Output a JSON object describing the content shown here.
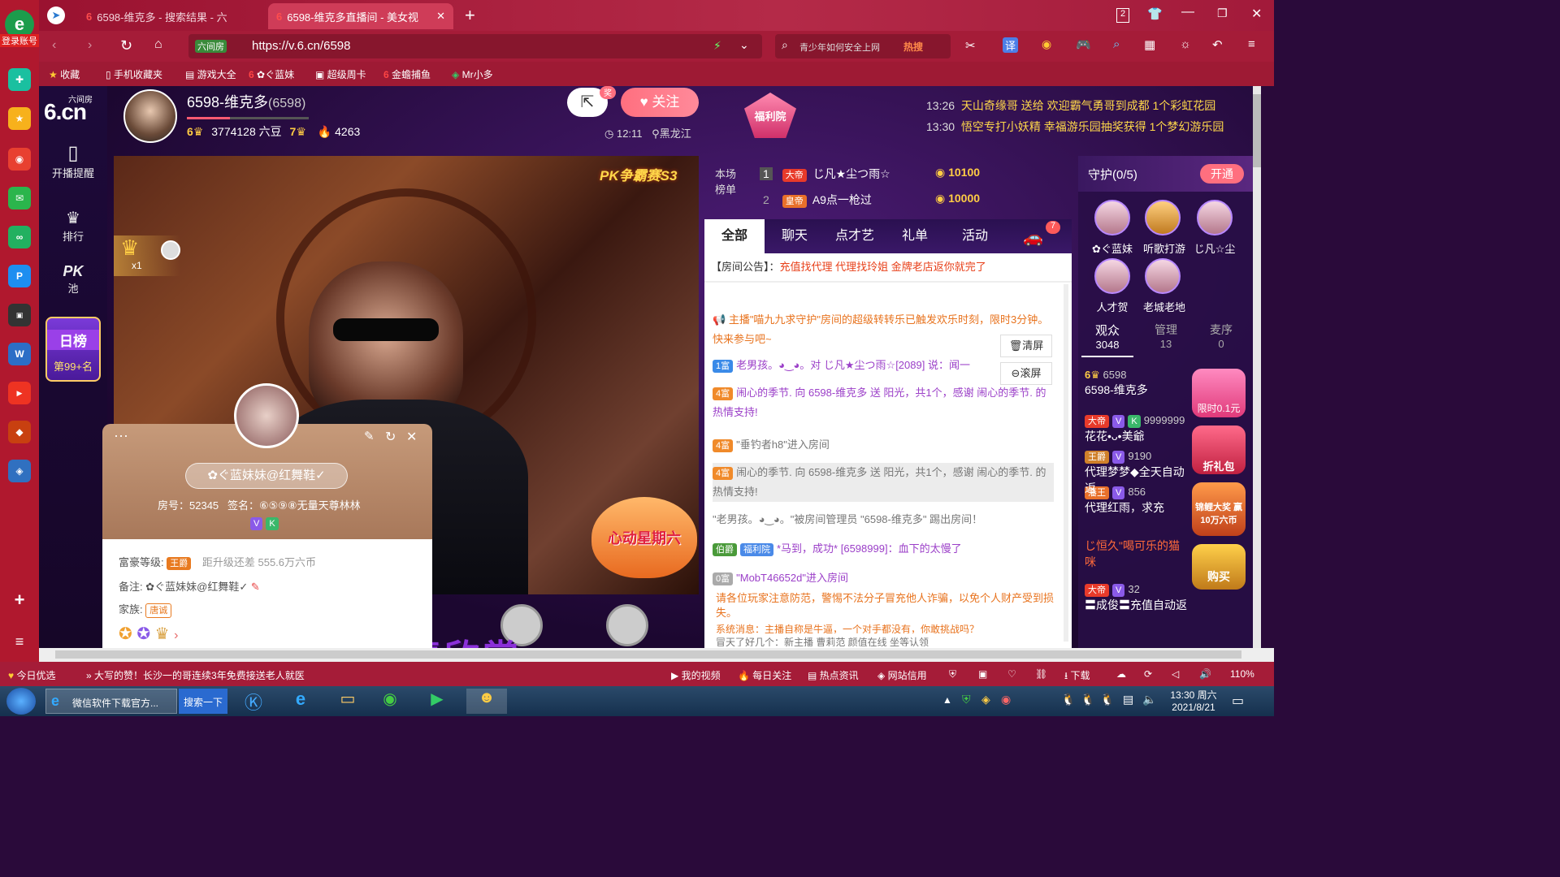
{
  "browser": {
    "login_label": "登录账号",
    "tabs": [
      {
        "label": "6598-维克多 - 搜索结果 - 六"
      },
      {
        "label": "6598-维克多直播间 - 美女视"
      }
    ],
    "tab_count": "2",
    "url": "https://v.6.cn/6598",
    "secure_label": "六间房",
    "search_placeholder": "青少年如何安全上网",
    "search_hot": "热搜",
    "bookmarks": [
      "收藏",
      "手机收藏夹",
      "游戏大全",
      "ぐ蓝妹",
      "超级周卡",
      "金蟾捕鱼",
      "Mr小多"
    ]
  },
  "site": {
    "logo_top": "六间房",
    "logo_main": "6.cn",
    "nav": [
      {
        "label": "开播提醒"
      },
      {
        "label": "排行"
      },
      {
        "label": "池"
      }
    ],
    "pk_label": "PK",
    "daily_rank": {
      "title": "日榜",
      "rank": "第99+名"
    }
  },
  "anchor": {
    "name": "6598-维克多",
    "room_id": "(6598)",
    "level_left": "6",
    "level_right": "7",
    "beans": "3774128 六豆",
    "fans": "4263",
    "follow_label": "关注",
    "time": "12:11",
    "location": "黑龙江",
    "share_badge": "奖"
  },
  "welfare": {
    "label": "福利院"
  },
  "notices": [
    {
      "time": "13:26",
      "text": "天山奇缘哥 送给 欢迎霸气勇哥到成都 1个彩虹花园"
    },
    {
      "time": "13:30",
      "text": "悟空专打小妖精 幸福游乐园抽奖获得 1个梦幻游乐园"
    }
  ],
  "video": {
    "event_badge": "PK争霸赛S3",
    "promo": "心动星期六",
    "gift_count": "x1",
    "subtitle": "纯音乐，请欣赏"
  },
  "rank": {
    "title": "本场榜单",
    "rows": [
      {
        "no": "1",
        "title": "大帝",
        "name": "じ凡★尘つ雨☆",
        "coins": "10100"
      },
      {
        "no": "2",
        "title": "皇帝",
        "name": "A9点一枪过",
        "coins": "10000"
      }
    ]
  },
  "chat": {
    "tabs": [
      "全部",
      "聊天",
      "点才艺",
      "礼单",
      "活动"
    ],
    "car_badge": "7",
    "announcement_label": "【房间公告】：",
    "announcement": "充值找代理 代理找玲姐 金牌老店返你就完了",
    "clear_label": "清屏",
    "scroll_label": "滚屏",
    "messages": [
      {
        "text": "主播\"喵九九求守护\"房间的超级转转乐已触发欢乐时刻，限时3分钟。快来参与吧~"
      },
      {
        "badge": "1富",
        "text": "老男孩。◕‿◕。对 じ凡★尘つ雨☆[2089] 说：闻一"
      },
      {
        "badge": "4富",
        "text": "闹心的季节. 向 6598-维克多 送 阳光，共1个，感谢 闹心的季节. 的热情支持!"
      },
      {
        "badge": "4富",
        "text": "\"垂钓者h8\"进入房间"
      },
      {
        "badge": "4富",
        "text": "闹心的季节. 向 6598-维克多 送 阳光，共1个，感谢 闹心的季节. 的热情支持!"
      },
      {
        "text": "\"老男孩。◕‿◕。\"被房间管理员 \"6598-维克多\" 踢出房间！"
      },
      {
        "badge": "伯爵",
        "badge2": "福利院",
        "text": "*马到，成功* [6598999]：血下的太慢了"
      },
      {
        "badge": "0富",
        "text": "\"MobT46652d\"进入房间"
      }
    ],
    "warning": "请各位玩家注意防范，警惕不法分子冒充他人诈骗，以免个人财产受到损失。",
    "system": "系统消息：主播自称是牛逼，一个对手都没有，你敢挑战吗？",
    "last": "冒天了好几个：新主播 曹莉范 颜值在线 坐等认领"
  },
  "guard": {
    "title": "守护(0/5)",
    "open_label": "开通",
    "members": [
      {
        "name": "✿ぐ蓝妹"
      },
      {
        "name": "听歌打游"
      },
      {
        "name": "じ凡☆尘"
      },
      {
        "name": "人才贺"
      },
      {
        "name": "老城老地"
      }
    ],
    "stats": [
      {
        "label": "观众",
        "value": "3048"
      },
      {
        "label": "管理",
        "value": "13"
      },
      {
        "label": "麦序",
        "value": "0"
      }
    ],
    "fans": [
      {
        "level": "6",
        "id": "6598",
        "name": "6598-维克多"
      },
      {
        "badge": "大帝",
        "id": "9999999",
        "name": "花花•ᴗ•美爺"
      },
      {
        "name": "じ恒久\"喝可乐的猫咪"
      },
      {
        "badge": "大帝",
        "id": "32",
        "name": "〓成俊〓充值自动返"
      },
      {
        "badge": "藩王",
        "id": "856",
        "name": "代理红雨，求充"
      },
      {
        "badge": "王爵",
        "id": "9190",
        "name": "代理梦梦◆全天自动返"
      }
    ],
    "promos": [
      "限时0.1元",
      "折礼包",
      "锦鲤大奖 赢10万六币",
      "购买"
    ]
  },
  "user_card": {
    "name": "✿ぐ蓝妹妹@红舞鞋✓",
    "room": "房号：52345",
    "sign": "签名：⑥⑤⑨⑧无量天尊林林",
    "wealth_label": "富豪等级:",
    "wealth_badge": "王爵",
    "wealth_next": "距升级还差 555.6万六币",
    "remark_label": "备注:",
    "remark": "✿ぐ蓝妹妹@红舞鞋✓",
    "family_label": "家族:",
    "family": "唐诚"
  },
  "status_bar": {
    "left": "今日优选",
    "news": "大写的赞！长沙一的哥连续3年免费接送老人就医",
    "items": [
      "我的视频",
      "每日关注",
      "热点资讯",
      "网站信用",
      "下载"
    ],
    "zoom": "110%"
  },
  "taskbar": {
    "task1": "微信软件下载官方...",
    "search": "搜索一下",
    "time": "13:30 周六",
    "date": "2021/8/21"
  },
  "colors": {
    "accent": "#ff6f7f",
    "browser": "#a51c38",
    "page_bg": "#2a0a3a"
  }
}
